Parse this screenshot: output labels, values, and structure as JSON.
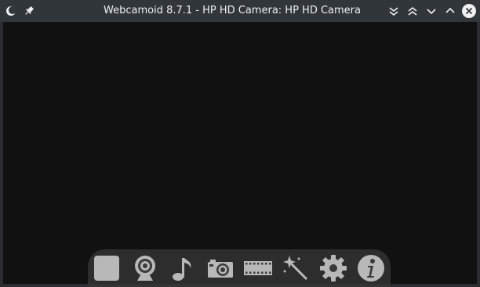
{
  "window": {
    "title": "Webcamoid 8.7.1 - HP HD Camera: HP HD Camera"
  },
  "titlebar": {
    "app_icon": "crescent-icon",
    "pin_icon": "pin-icon",
    "buttons": [
      "keep-below-icon",
      "keep-above-icon",
      "minimize-icon",
      "maximize-icon",
      "close-icon"
    ]
  },
  "toolbar": {
    "items": [
      {
        "name": "stop-button",
        "icon": "stop-icon"
      },
      {
        "name": "webcam-button",
        "icon": "webcam-icon"
      },
      {
        "name": "audio-button",
        "icon": "music-note-icon"
      },
      {
        "name": "take-photo-button",
        "icon": "camera-icon"
      },
      {
        "name": "record-video-button",
        "icon": "film-strip-icon"
      },
      {
        "name": "effects-button",
        "icon": "magic-wand-icon"
      },
      {
        "name": "settings-button",
        "icon": "gear-icon"
      },
      {
        "name": "about-button",
        "icon": "info-icon"
      }
    ]
  },
  "colors": {
    "titlebar_bg": "#31363b",
    "title_text": "#eff0f1",
    "viewport_bg": "#111111",
    "icon_color": "#b8b8b8"
  }
}
